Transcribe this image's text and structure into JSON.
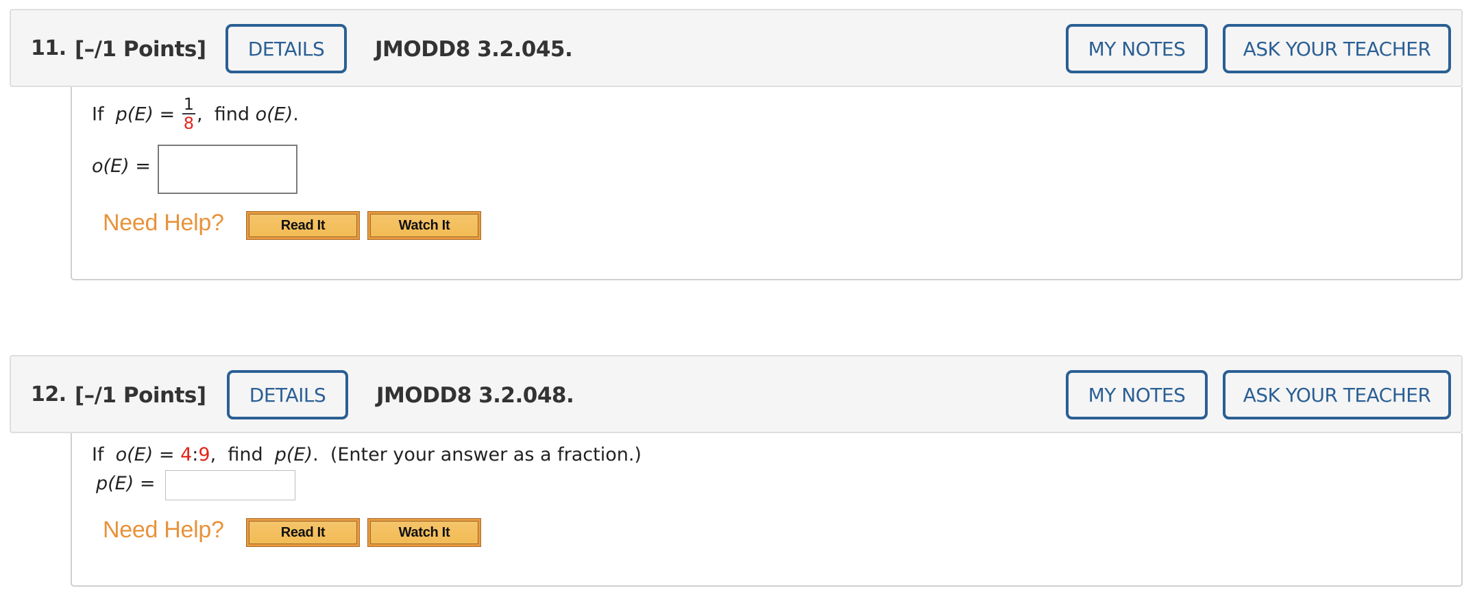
{
  "questions": [
    {
      "number": "11.",
      "points": "[–/1 Points]",
      "details_label": "DETAILS",
      "title": "JMODD8 3.2.045.",
      "my_notes_label": "MY NOTES",
      "ask_teacher_label": "ASK YOUR TEACHER",
      "prompt": {
        "if": "If",
        "given_fn": "p(E)",
        "equals": "=",
        "numerator": "1",
        "denominator": "8",
        "comma": ",",
        "find": "find",
        "target_fn": "o(E)",
        "period": "."
      },
      "answer_label": "o(E) =",
      "answer_value": "",
      "need_help_label": "Need Help?",
      "read_it_label": "Read It",
      "watch_it_label": "Watch It"
    },
    {
      "number": "12.",
      "points": "[–/1 Points]",
      "details_label": "DETAILS",
      "title": "JMODD8 3.2.048.",
      "my_notes_label": "MY NOTES",
      "ask_teacher_label": "ASK YOUR TEACHER",
      "prompt": {
        "if": "If",
        "given_fn": "o(E)",
        "equals": "=",
        "odds_a": "4",
        "colon": ":",
        "odds_b": "9",
        "comma": ",",
        "find": "find",
        "target_fn": "p(E)",
        "period": ".",
        "instruction": "(Enter your answer as a fraction.)"
      },
      "answer_label": "p(E) =",
      "answer_value": "",
      "need_help_label": "Need Help?",
      "read_it_label": "Read It",
      "watch_it_label": "Watch It"
    }
  ],
  "colors": {
    "accent_blue": "#2a5f94",
    "highlight_red": "#e3241b",
    "help_orange": "#e8923a",
    "help_button": "#f2bb55"
  }
}
